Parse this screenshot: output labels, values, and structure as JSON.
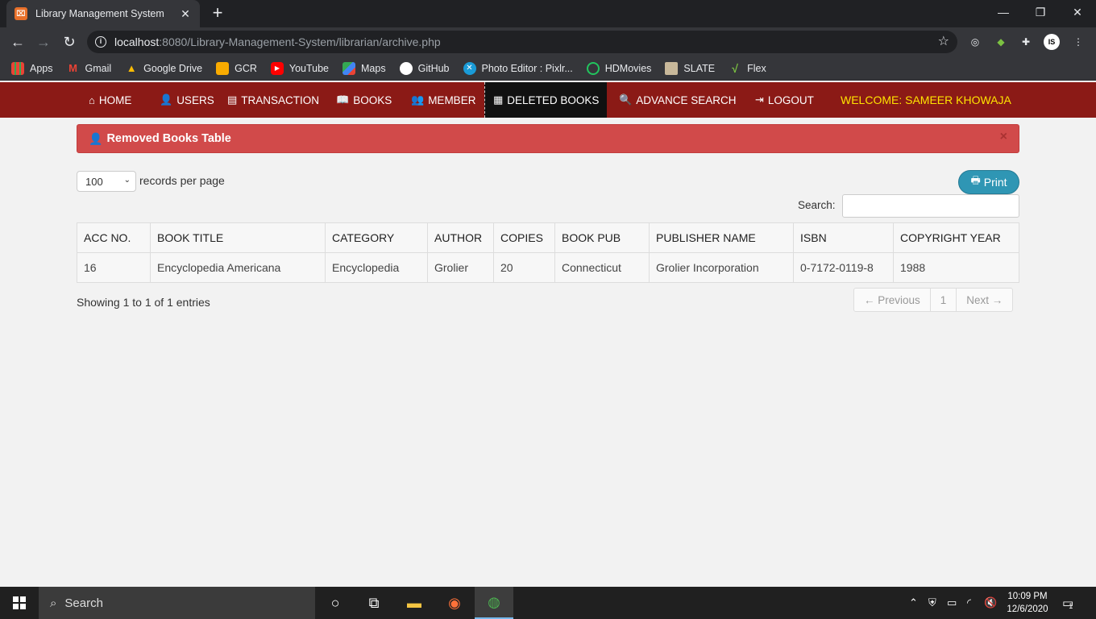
{
  "browser": {
    "tab_title": "Library Management System",
    "tab_favicon_text": "⌧",
    "url_host": "localhost",
    "url_rest": ":8080/Library-Management-System/librarian/archive.php",
    "bookmarks": [
      {
        "label": "Apps",
        "icon": "apps-grid-icon",
        "color": "#4285f4"
      },
      {
        "label": "Gmail",
        "icon": "gmail-icon",
        "color": "#ea4335"
      },
      {
        "label": "Google Drive",
        "icon": "google-drive-icon",
        "color": "#fbbc04"
      },
      {
        "label": "GCR",
        "icon": "google-classroom-icon",
        "color": "#f9ab00"
      },
      {
        "label": "YouTube",
        "icon": "youtube-icon",
        "color": "#ff0000"
      },
      {
        "label": "Maps",
        "icon": "maps-icon",
        "color": "#34a853"
      },
      {
        "label": "GitHub",
        "icon": "github-icon",
        "color": "#ffffff"
      },
      {
        "label": "Photo Editor : Pixlr...",
        "icon": "pixlr-icon",
        "color": "#1a9bd7"
      },
      {
        "label": "HDMovies",
        "icon": "hdmovies-icon",
        "color": "#22c55e"
      },
      {
        "label": "SLATE",
        "icon": "slate-icon",
        "color": "#c8b89a"
      },
      {
        "label": "Flex",
        "icon": "flex-icon",
        "color": "#7cc242"
      }
    ]
  },
  "nav": {
    "items": [
      {
        "label": "HOME",
        "icon": "⌂"
      },
      {
        "label": "USERS",
        "icon": "👤"
      },
      {
        "label": "TRANSACTION",
        "icon": "▤"
      },
      {
        "label": "BOOKS",
        "icon": "📖"
      },
      {
        "label": "MEMBER",
        "icon": "👥"
      },
      {
        "label": "DELETED BOOKS",
        "icon": "▦"
      },
      {
        "label": "ADVANCE SEARCH",
        "icon": "🔍"
      },
      {
        "label": "LOGOUT",
        "icon": "⇥"
      }
    ],
    "welcome": "WELCOME: SAMEER KHOWAJA",
    "accent_color": "#8b1a16",
    "welcome_color": "#ffe400"
  },
  "panel": {
    "title": "Removed Books Table",
    "close": "×"
  },
  "table_controls": {
    "records_value": "100",
    "records_label": "records per page",
    "print_label": "Print",
    "search_label": "Search:"
  },
  "table": {
    "headers": [
      "ACC NO.",
      "BOOK TITLE",
      "CATEGORY",
      "AUTHOR",
      "COPIES",
      "BOOK PUB",
      "PUBLISHER NAME",
      "ISBN",
      "COPYRIGHT YEAR"
    ],
    "rows": [
      [
        "16",
        "Encyclopedia Americana",
        "Encyclopedia",
        "Grolier",
        "20",
        "Connecticut",
        "Grolier Incorporation",
        "0-7172-0119-8",
        "1988"
      ]
    ]
  },
  "footer": {
    "info": "Showing 1 to 1 of 1 entries",
    "prev": "← Previous",
    "page": "1",
    "next": "Next →"
  },
  "taskbar": {
    "search_placeholder": "Search",
    "time": "10:09 PM",
    "date": "12/6/2020",
    "notification_count": "1"
  }
}
